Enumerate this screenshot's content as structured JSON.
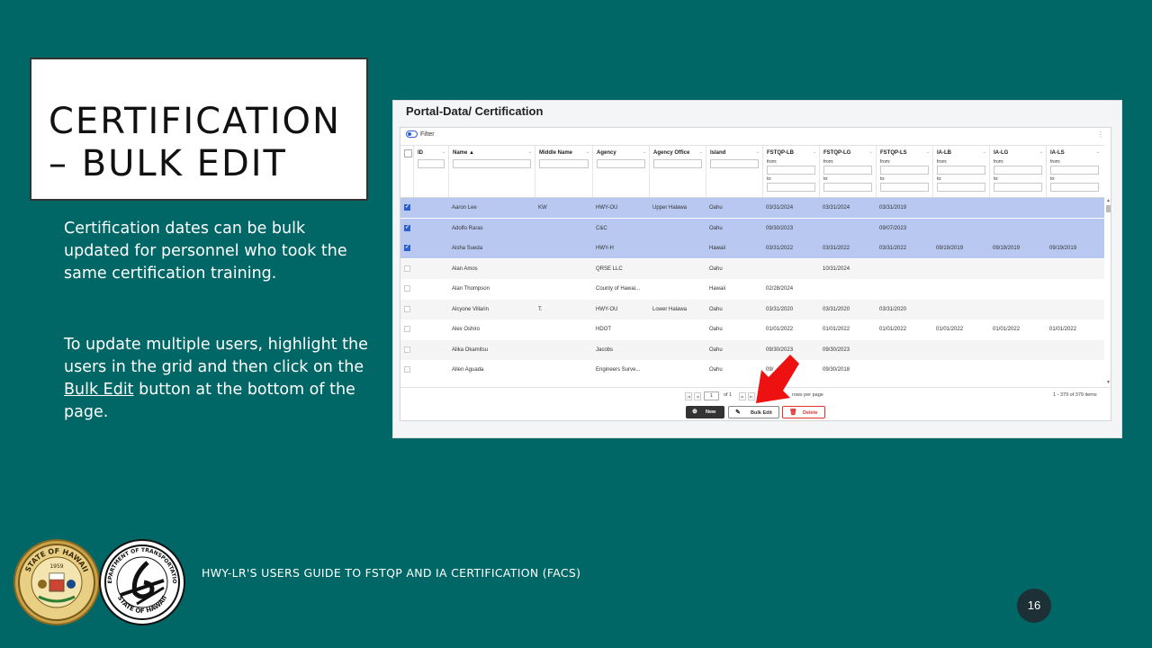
{
  "slide": {
    "title_line1": "CERTIFICATION",
    "title_line2": "– BULK EDIT",
    "para1": "Certification dates can be bulk updated for personnel who took the same certification training.",
    "para2_prefix": "To update multiple users, highlight the users in the grid and then click on the ",
    "para2_link": "Bulk Edit",
    "para2_suffix": " button at the bottom of the page.",
    "footer": "HWY-LR'S USERS GUIDE TO FSTQP AND IA CERTIFICATION (FACS)",
    "page_number": "16",
    "seal1_top": "STATE OF HAWAII",
    "seal1_year": "1959",
    "seal2_top": "DEPARTMENT OF TRANSPORTATION",
    "seal2_bottom": "STATE OF HAWAII",
    "accent": "#006766",
    "arrow_color": "#ee1111"
  },
  "app": {
    "title": "Portal-Data/ Certification",
    "filter_label": "Filter",
    "kebab": "⋮",
    "from_label": "from:",
    "to_label": "to:",
    "columns": [
      "ID",
      "Name ▲",
      "Middle Name",
      "Agency",
      "Agency Office",
      "Island",
      "FSTQP-LB",
      "FSTQP-LG",
      "FSTQP-LS",
      "IA-LB",
      "IA-LG",
      "IA-LS"
    ],
    "rows": [
      {
        "selected": true,
        "cells": [
          "",
          "Aaron Lee",
          "KW",
          "HWY-OU",
          "Upper Halawa",
          "Oahu",
          "03/31/2024",
          "03/31/2024",
          "03/31/2019",
          "",
          "",
          ""
        ]
      },
      {
        "selected": true,
        "cells": [
          "",
          "Adolfo Raras",
          "",
          "C&C",
          "",
          "Oahu",
          "09/30/2023",
          "",
          "09/07/2023",
          "",
          "",
          ""
        ]
      },
      {
        "selected": true,
        "cells": [
          "",
          "Aisha Sueda",
          "",
          "HWY-H",
          "",
          "Hawaii",
          "03/31/2022",
          "03/31/2022",
          "03/31/2022",
          "09/19/2019",
          "09/19/2019",
          "09/19/2019"
        ]
      },
      {
        "selected": false,
        "cells": [
          "",
          "Alan Amos",
          "",
          "QRSE LLC",
          "",
          "Oahu",
          "",
          "10/31/2024",
          "",
          "",
          "",
          ""
        ]
      },
      {
        "selected": false,
        "cells": [
          "",
          "Alan Thompson",
          "",
          "County of Hawai...",
          "",
          "Hawaii",
          "02/28/2024",
          "",
          "",
          "",
          "",
          ""
        ]
      },
      {
        "selected": false,
        "cells": [
          "",
          "Alcyone Villarin",
          "T.",
          "HWY-OU",
          "Lower Halawa",
          "Oahu",
          "03/31/2020",
          "03/31/2020",
          "03/31/2020",
          "",
          "",
          ""
        ]
      },
      {
        "selected": false,
        "cells": [
          "",
          "Alex Oshiro",
          "",
          "HDOT",
          "",
          "Oahu",
          "01/01/2022",
          "01/01/2022",
          "01/01/2022",
          "01/01/2022",
          "01/01/2022",
          "01/01/2022"
        ]
      },
      {
        "selected": false,
        "cells": [
          "",
          "Alika Okamitsu",
          "",
          "Jacobs",
          "",
          "Oahu",
          "09/30/2023",
          "09/30/2023",
          "",
          "",
          "",
          ""
        ]
      },
      {
        "selected": false,
        "cells": [
          "",
          "Allen Aguada",
          "",
          "Engineers Surve...",
          "",
          "Oahu",
          "09/",
          "09/30/2018",
          "",
          "",
          "",
          ""
        ]
      }
    ],
    "pager": {
      "page": "1",
      "of": "of 1",
      "rows_per_page": "rows per page",
      "range": "1 - 379 of 379 items"
    },
    "buttons": {
      "new": "New",
      "bulk_edit": "Bulk Edit",
      "delete": "Delete"
    }
  }
}
